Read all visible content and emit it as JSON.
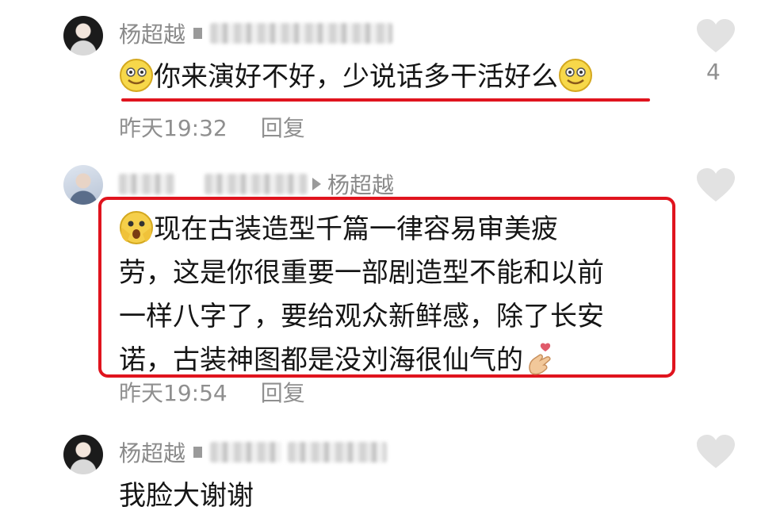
{
  "comments": [
    {
      "author": "杨超越",
      "reply_to": "",
      "text": "你来演好不好，少说话多干活好么",
      "time": "昨天19:32",
      "reply_label": "回复",
      "likes": "4"
    },
    {
      "author": "",
      "reply_to": "杨超越",
      "lines": [
        "现在古装造型千篇一律容易审美疲",
        "劳，这是你很重要一部剧造型不能和以前",
        "一样八字了，要给观众新鲜感，除了长安",
        "诺，古装神图都是没刘海很仙气的"
      ],
      "time": "昨天19:54",
      "reply_label": "回复",
      "likes": ""
    },
    {
      "author": "杨超越",
      "reply_to": "",
      "text": "我脸大谢谢",
      "likes": ""
    }
  ],
  "colors": {
    "highlight": "#e0141e",
    "meta": "#8a8a8a",
    "heart": "#e2e2e2"
  },
  "icons": [
    "smile-emoji-icon",
    "shocked-emoji-icon",
    "finger-heart-emoji-icon",
    "heart-like-icon",
    "play-arrow-icon"
  ]
}
